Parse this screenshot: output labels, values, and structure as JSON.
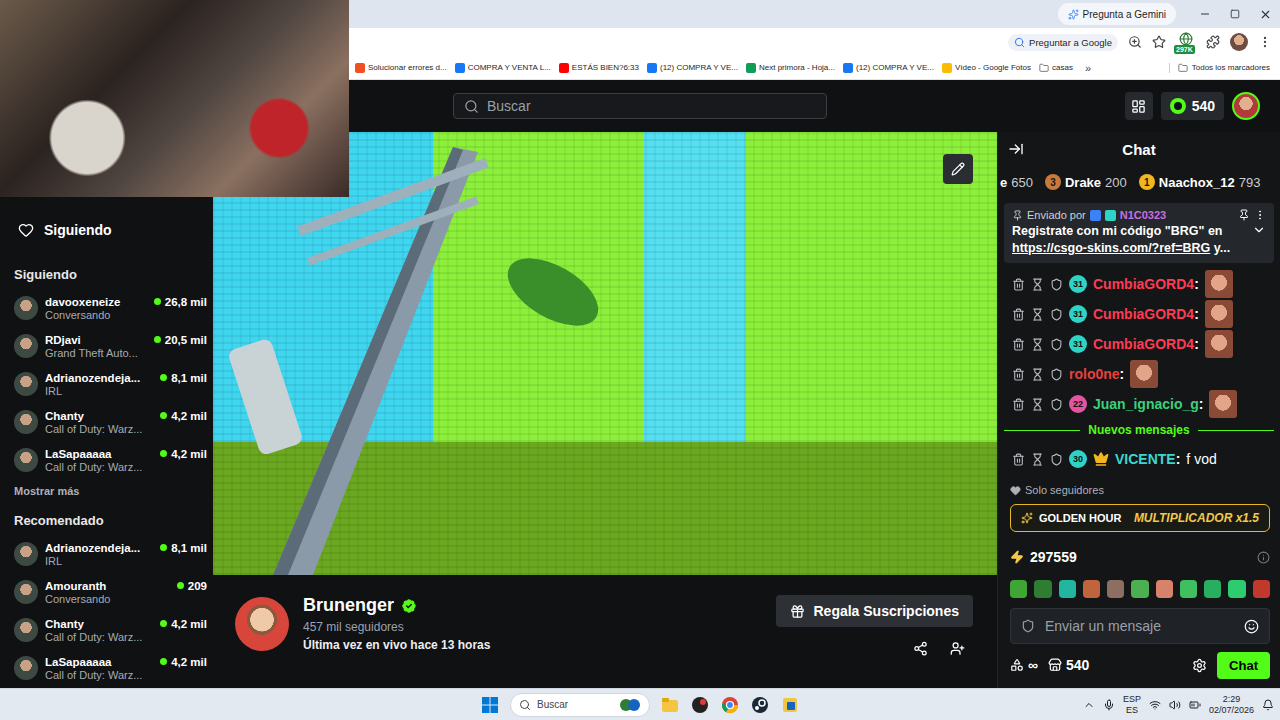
{
  "browser": {
    "gemini_button": "Pregunta a Gemini",
    "ask_google": "Preguntar a Google",
    "extension_badge": "297K",
    "bookmarks": [
      {
        "label": "Solucionar errores d...",
        "color": "#f25022",
        "kind": "site"
      },
      {
        "label": "COMPRA Y VENTA L...",
        "color": "#1877f2",
        "kind": "site"
      },
      {
        "label": "ESTÁS BIEN?6:33",
        "color": "#ff0000",
        "kind": "site"
      },
      {
        "label": "(12) COMPRA Y VE...",
        "color": "#1877f2",
        "kind": "site"
      },
      {
        "label": "Next primora - Hoja...",
        "color": "#0f9d58",
        "kind": "site"
      },
      {
        "label": "(12) COMPRA Y VE...",
        "color": "#1877f2",
        "kind": "site"
      },
      {
        "label": "Vídeo - Google Fotos",
        "color": "#fbbc04",
        "kind": "site"
      },
      {
        "label": "casas",
        "color": "#5f6368",
        "kind": "folder"
      }
    ],
    "bookmarks_overflow": "»",
    "all_bookmarks": "Todos los marcadores"
  },
  "kick": {
    "search_placeholder": "Buscar",
    "points": "540"
  },
  "sidebar": {
    "title": "Siguiendo",
    "following_label": "Siguiendo",
    "following": [
      {
        "name": "davooxeneize",
        "category": "Conversando",
        "viewers": "26,8 mil",
        "live": true
      },
      {
        "name": "RDjavi",
        "category": "Grand Theft Auto...",
        "viewers": "20,5 mil",
        "live": true
      },
      {
        "name": "Adrianozendeja...",
        "category": "IRL",
        "viewers": "8,1 mil",
        "live": true
      },
      {
        "name": "Chanty",
        "category": "Call of Duty: Warz...",
        "viewers": "4,2 mil",
        "live": true
      },
      {
        "name": "LaSapaaaaa",
        "category": "Call of Duty: Warz...",
        "viewers": "4,2 mil",
        "live": true
      }
    ],
    "show_more": "Mostrar más",
    "recommended_label": "Recomendado",
    "recommended": [
      {
        "name": "Adrianozendeja...",
        "category": "IRL",
        "viewers": "8,1 mil",
        "live": true
      },
      {
        "name": "Amouranth",
        "category": "Conversando",
        "viewers": "209",
        "live": true
      },
      {
        "name": "Chanty",
        "category": "Call of Duty: Warz...",
        "viewers": "4,2 mil",
        "live": true
      },
      {
        "name": "LaSapaaaaa",
        "category": "Call of Duty: Warz...",
        "viewers": "4,2 mil",
        "live": true
      }
    ]
  },
  "stream": {
    "offline": true,
    "channel": {
      "name": "Brunenger",
      "verified": true,
      "followers": "457 mil seguidores",
      "last_live": "Última vez en vivo hace 13 horas",
      "gift_button": "Regala Suscripciones"
    }
  },
  "chat": {
    "title": "Chat",
    "leaderboard": [
      {
        "rank": null,
        "name": "e",
        "points": "650",
        "color": "#00000000"
      },
      {
        "rank": "3",
        "name": "Drake",
        "points": "200",
        "color": "#c67a3c"
      },
      {
        "rank": "1",
        "name": "Naachox_12",
        "points": "793",
        "color": "#f2b71f"
      }
    ],
    "pinned": {
      "sent_by": "Enviado por",
      "author": "N1C0323",
      "author_color": "#c86fe0",
      "text": "Registrate con mi código \"BRG\" en ",
      "link": "https://csgo-skins.com/?ref=BRG",
      "tail": " y..."
    },
    "messages": [
      {
        "user": "CumbiaGORD4",
        "color": "#ff3b53",
        "badge": "31",
        "badge_color": "#2fd3c6",
        "crown": false,
        "separator": ":",
        "kind": "emote",
        "text": null
      },
      {
        "user": "CumbiaGORD4",
        "color": "#ff3b53",
        "badge": "31",
        "badge_color": "#2fd3c6",
        "crown": false,
        "separator": ":",
        "kind": "emote",
        "text": null
      },
      {
        "user": "CumbiaGORD4",
        "color": "#ff3b53",
        "badge": "31",
        "badge_color": "#2fd3c6",
        "crown": false,
        "separator": ":",
        "kind": "emote",
        "text": null
      },
      {
        "user": "rolo0ne",
        "color": "#e8413c",
        "badge": null,
        "badge_color": null,
        "crown": false,
        "separator": ":",
        "kind": "emote",
        "text": null
      },
      {
        "user": "Juan_ignacio_g",
        "color": "#3cd07b",
        "badge": "22",
        "badge_color": "#e2559f",
        "crown": false,
        "separator": ":",
        "kind": "emote",
        "text": null
      }
    ],
    "new_messages_label": "Nuevos mensajes",
    "new_messages": [
      {
        "user": "VICENTE",
        "color": "#3ed6d1",
        "badge": "30",
        "badge_color": "#2fd3c6",
        "crown": true,
        "separator": ":",
        "kind": "text",
        "text": "f vod"
      }
    ],
    "followers_only": "Solo seguidores",
    "golden_hour": {
      "label": "GOLDEN HOUR",
      "multiplier": "MULTIPLICADOR x1.5"
    },
    "channel_points": "297559",
    "quick_emotes": [
      "#3fa535",
      "#2e7d32",
      "#23b5a0",
      "#c0643c",
      "#8d6e63",
      "#4caf50",
      "#d9826b",
      "#3fbf5f",
      "#27ae60",
      "#2ecc71",
      "#c0392b"
    ],
    "input_placeholder": "Enviar un mensaje",
    "infinity": "∞",
    "store_points": "540",
    "send_button": "Chat"
  },
  "taskbar": {
    "search_placeholder": "Buscar",
    "lang_top": "ESP",
    "lang_bottom": "ES",
    "time": "2:29",
    "date": "02/07/2026"
  }
}
